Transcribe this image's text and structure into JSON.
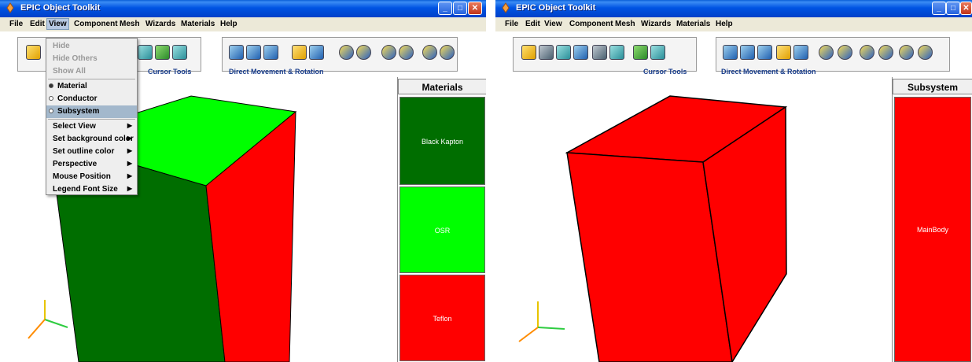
{
  "windows": [
    {
      "title": "EPIC Object Toolkit",
      "menus": [
        "File",
        "Edit",
        "View",
        "Component",
        "Mesh",
        "Wizards",
        "Materials",
        "Help"
      ],
      "toolbar": {
        "cursor_label": "Cursor Tools",
        "movement_label": "Direct Movement & Rotation"
      },
      "legend": {
        "header": "Materials",
        "items": [
          {
            "label": "Black Kapton",
            "color": "#006e00"
          },
          {
            "label": "OSR",
            "color": "#00ff00"
          },
          {
            "label": "Teflon",
            "color": "#ff0000"
          }
        ]
      },
      "view_menu": {
        "items": [
          {
            "label": "Hide",
            "enabled": false
          },
          {
            "label": "Hide Others",
            "enabled": false
          },
          {
            "label": "Show All",
            "enabled": false
          },
          {
            "label": "Material",
            "radio": true,
            "checked": true
          },
          {
            "label": "Conductor",
            "radio": true,
            "checked": false
          },
          {
            "label": "Subsystem",
            "radio": true,
            "checked": false,
            "highlighted": true
          },
          {
            "label": "Select View",
            "submenu": true
          },
          {
            "label": "Set background color",
            "submenu": true
          },
          {
            "label": "Set outline color",
            "submenu": true
          },
          {
            "label": "Perspective",
            "submenu": true
          },
          {
            "label": "Mouse Position",
            "submenu": true
          },
          {
            "label": "Legend Font Size",
            "submenu": true
          }
        ]
      },
      "cube_colors": {
        "top": "#00ff00",
        "left": "#006e00",
        "right": "#ff0000"
      }
    },
    {
      "title": "EPIC Object Toolkit",
      "menus": [
        "File",
        "Edit",
        "View",
        "Component",
        "Mesh",
        "Wizards",
        "Materials",
        "Help"
      ],
      "toolbar": {
        "cursor_label": "Cursor Tools",
        "movement_label": "Direct Movement & Rotation"
      },
      "legend": {
        "header": "Subsystem",
        "items": [
          {
            "label": "MainBody",
            "color": "#ff0000"
          }
        ]
      },
      "cube_colors": {
        "top": "#ff0000",
        "left": "#ff0000",
        "right": "#ff0000"
      }
    }
  ],
  "axis_colors": {
    "x": "#2ecc40",
    "y": "#e8c400",
    "z": "#ff8c00"
  }
}
